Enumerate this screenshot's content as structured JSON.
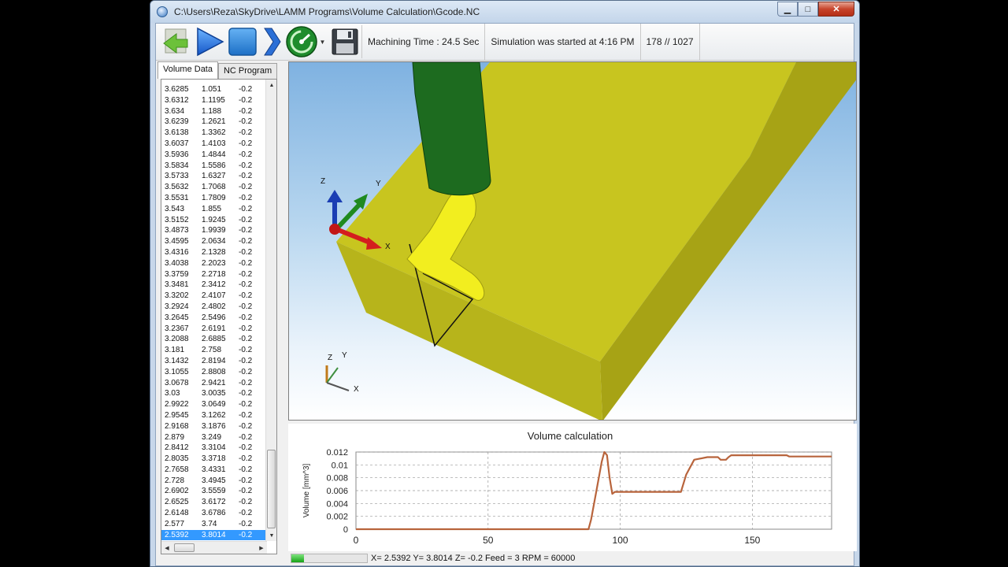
{
  "window": {
    "title": "C:\\Users\\Reza\\SkyDrive\\LAMM Programs\\Volume Calculation\\Gcode.NC",
    "minimize": "▁",
    "maximize": "□",
    "close": "✕"
  },
  "toolbar": {
    "buttons": [
      {
        "name": "back-arrow-icon"
      },
      {
        "name": "play-icon"
      },
      {
        "name": "stop-icon"
      },
      {
        "name": "step-forward-icon"
      },
      {
        "name": "speed-gauge-icon"
      },
      {
        "name": "save-icon"
      }
    ],
    "machining_time": "Machining Time : 24.5 Sec",
    "simulation_started": "Simulation was started at 4:16 PM",
    "counter": "178 // 1027"
  },
  "tabs": [
    "Volume Data",
    "NC Program"
  ],
  "volume_rows": [
    [
      "3.6285",
      "1.051",
      "-0.2"
    ],
    [
      "3.6312",
      "1.1195",
      "-0.2"
    ],
    [
      "3.634",
      "1.188",
      "-0.2"
    ],
    [
      "3.6239",
      "1.2621",
      "-0.2"
    ],
    [
      "3.6138",
      "1.3362",
      "-0.2"
    ],
    [
      "3.6037",
      "1.4103",
      "-0.2"
    ],
    [
      "3.5936",
      "1.4844",
      "-0.2"
    ],
    [
      "3.5834",
      "1.5586",
      "-0.2"
    ],
    [
      "3.5733",
      "1.6327",
      "-0.2"
    ],
    [
      "3.5632",
      "1.7068",
      "-0.2"
    ],
    [
      "3.5531",
      "1.7809",
      "-0.2"
    ],
    [
      "3.543",
      "1.855",
      "-0.2"
    ],
    [
      "3.5152",
      "1.9245",
      "-0.2"
    ],
    [
      "3.4873",
      "1.9939",
      "-0.2"
    ],
    [
      "3.4595",
      "2.0634",
      "-0.2"
    ],
    [
      "3.4316",
      "2.1328",
      "-0.2"
    ],
    [
      "3.4038",
      "2.2023",
      "-0.2"
    ],
    [
      "3.3759",
      "2.2718",
      "-0.2"
    ],
    [
      "3.3481",
      "2.3412",
      "-0.2"
    ],
    [
      "3.3202",
      "2.4107",
      "-0.2"
    ],
    [
      "3.2924",
      "2.4802",
      "-0.2"
    ],
    [
      "3.2645",
      "2.5496",
      "-0.2"
    ],
    [
      "3.2367",
      "2.6191",
      "-0.2"
    ],
    [
      "3.2088",
      "2.6885",
      "-0.2"
    ],
    [
      "3.181",
      "2.758",
      "-0.2"
    ],
    [
      "3.1432",
      "2.8194",
      "-0.2"
    ],
    [
      "3.1055",
      "2.8808",
      "-0.2"
    ],
    [
      "3.0678",
      "2.9421",
      "-0.2"
    ],
    [
      "3.03",
      "3.0035",
      "-0.2"
    ],
    [
      "2.9922",
      "3.0649",
      "-0.2"
    ],
    [
      "2.9545",
      "3.1262",
      "-0.2"
    ],
    [
      "2.9168",
      "3.1876",
      "-0.2"
    ],
    [
      "2.879",
      "3.249",
      "-0.2"
    ],
    [
      "2.8412",
      "3.3104",
      "-0.2"
    ],
    [
      "2.8035",
      "3.3718",
      "-0.2"
    ],
    [
      "2.7658",
      "3.4331",
      "-0.2"
    ],
    [
      "2.728",
      "3.4945",
      "-0.2"
    ],
    [
      "2.6902",
      "3.5559",
      "-0.2"
    ],
    [
      "2.6525",
      "3.6172",
      "-0.2"
    ],
    [
      "2.6148",
      "3.6786",
      "-0.2"
    ],
    [
      "2.577",
      "3.74",
      "-0.2"
    ],
    [
      "2.5392",
      "3.8014",
      "-0.2"
    ]
  ],
  "selected_row": 41,
  "viewport": {
    "axis_labels": {
      "x": "X",
      "y": "Y",
      "z": "Z"
    },
    "colors": {
      "workpiece": "#c8c51f",
      "tool_shank": "#1d6b1f",
      "tool_tip": "#f2ee1f"
    }
  },
  "chart_data": {
    "type": "line",
    "title": "Volume calculation",
    "xlabel": "",
    "ylabel": "Volume [mm^3]",
    "xlim": [
      0,
      180
    ],
    "ylim": [
      0,
      0.012
    ],
    "xticks": [
      "0",
      "50",
      "100",
      "150"
    ],
    "yticks": [
      "0",
      "0.002",
      "0.004",
      "0.006",
      "0.008",
      "0.01",
      "0.012"
    ],
    "grid": true,
    "color": "#b8643c",
    "x": [
      0,
      88,
      89,
      91,
      93,
      94,
      95,
      96,
      97,
      98,
      104,
      120,
      123,
      125,
      128,
      133,
      137,
      138,
      140,
      141,
      142,
      145,
      150,
      163,
      164,
      180
    ],
    "values": [
      0,
      0,
      0.0015,
      0.006,
      0.0105,
      0.012,
      0.0115,
      0.008,
      0.0055,
      0.0058,
      0.0058,
      0.0058,
      0.0058,
      0.0085,
      0.0108,
      0.0112,
      0.0112,
      0.0108,
      0.0108,
      0.0112,
      0.0115,
      0.0115,
      0.0115,
      0.0115,
      0.0113,
      0.0113
    ]
  },
  "status": {
    "progress": 0.17,
    "coords": "X= 2.5392 Y= 3.8014 Z= -0.2 Feed = 3 RPM = 60000"
  }
}
